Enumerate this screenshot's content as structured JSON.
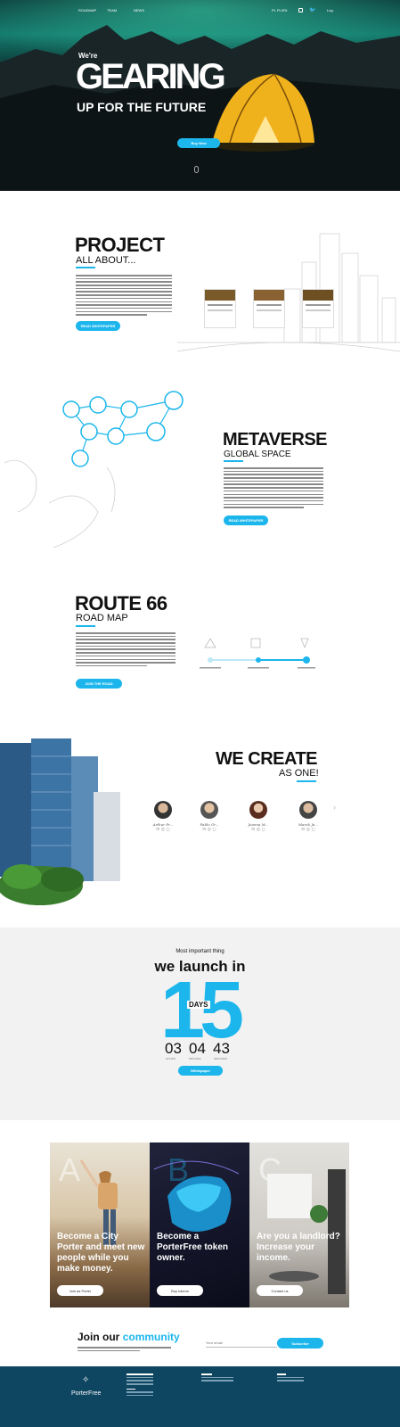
{
  "nav": {
    "left": [
      "ROADMAP",
      "TEAM",
      "NEWS"
    ],
    "pl_label": "PL PL/EN",
    "login": "Log"
  },
  "hero": {
    "line1": "We're",
    "line2": "GEARING",
    "line3": "UP FOR THE FUTURE",
    "button": "Buy Now"
  },
  "project": {
    "title": "PROJECT",
    "subtitle": "ALL ABOUT...",
    "button": "READ WHITEPAPER"
  },
  "metaverse": {
    "title": "METAVERSE",
    "subtitle": "GLOBAL SPACE",
    "button": "READ WHITEPAPER"
  },
  "roadmap": {
    "title": "ROUTE 66",
    "subtitle": "ROAD MAP",
    "button": "JOIN THE ROAD"
  },
  "team": {
    "title": "WE CREATE",
    "subtitle": "AS ONE!",
    "members": [
      {
        "signature": "Arthur Pr..."
      },
      {
        "signature": "Pablo Gr..."
      },
      {
        "signature": "Joanna M..."
      },
      {
        "signature": "Marek Ja..."
      }
    ]
  },
  "launch": {
    "pre": "Most important thing",
    "title": "we launch in",
    "big_number": "15",
    "days": "DAYS",
    "hours": "03",
    "minutes": "04",
    "seconds": "43",
    "hours_label": "HOURS",
    "minutes_label": "MINUTES",
    "seconds_label": "SECONDS",
    "button": "Whitepaper"
  },
  "cards": [
    {
      "letter": "A",
      "text": "Become a City Porter and meet new people while you make money.",
      "button": "Join as Porter"
    },
    {
      "letter": "B",
      "text": "Become a PorterFree token owner.",
      "button": "Buy tokens"
    },
    {
      "letter": "C",
      "text": "Are you a landlord? Increase your income.",
      "button": "Contact us"
    }
  ],
  "community": {
    "title_a": "Join our",
    "title_b": "community",
    "placeholder": "Your email",
    "button": "Subscribe"
  },
  "footer": {
    "brand": "PorterFree",
    "accent": "#1cb6ec",
    "dark": "#0e4561"
  }
}
